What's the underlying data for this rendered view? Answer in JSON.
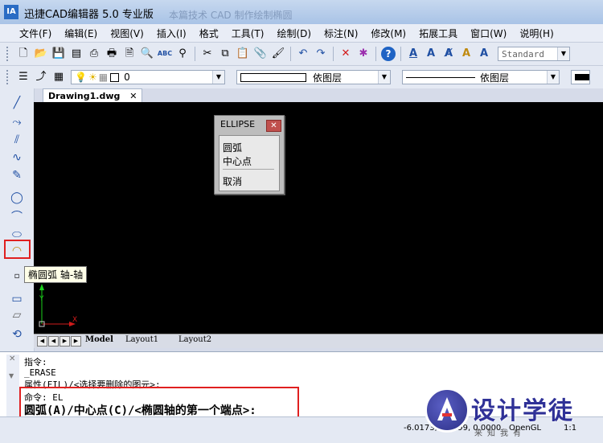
{
  "window": {
    "title": "迅捷CAD编辑器 5.0 专业版",
    "background_title": "本篇技术 CAD 制作绘制椭圆",
    "icon_text": "IA"
  },
  "menu": [
    "文件(F)",
    "编辑(E)",
    "视图(V)",
    "插入(I)",
    "格式",
    "工具(T)",
    "绘制(D)",
    "标注(N)",
    "修改(M)",
    "拓展工具",
    "窗口(W)",
    "说明(H)"
  ],
  "toolbar": {
    "text_style": "Standard",
    "layer_value": "0",
    "color_value": "依图层",
    "linetype_value": "依图层"
  },
  "document_tab": "Drawing1.dwg",
  "ellipse_menu": {
    "title": "ELLIPSE",
    "options": [
      "圆弧",
      "中心点",
      "取消"
    ]
  },
  "tooltip": "椭圆弧 轴-轴",
  "layout_tabs": [
    "Model",
    "Layout1",
    "Layout2"
  ],
  "command_lines": [
    "指令:",
    " _ERASE",
    "属性(FIL)/<选择要删除的图元>:",
    "命令: EL"
  ],
  "command_prompt": "圆弧(A)/中心点(C)/<椭圆轴的第一个端点>:",
  "status": {
    "coords": "-6.0173, 3.0599, 0.0000",
    "render": "OpenGL",
    "scale": "1:1"
  },
  "logo": {
    "main": "设计学徒",
    "sub": "来知我有"
  },
  "colors": {
    "canvas": "#000000",
    "highlight": "#e02020",
    "logo": "#2f3197"
  }
}
